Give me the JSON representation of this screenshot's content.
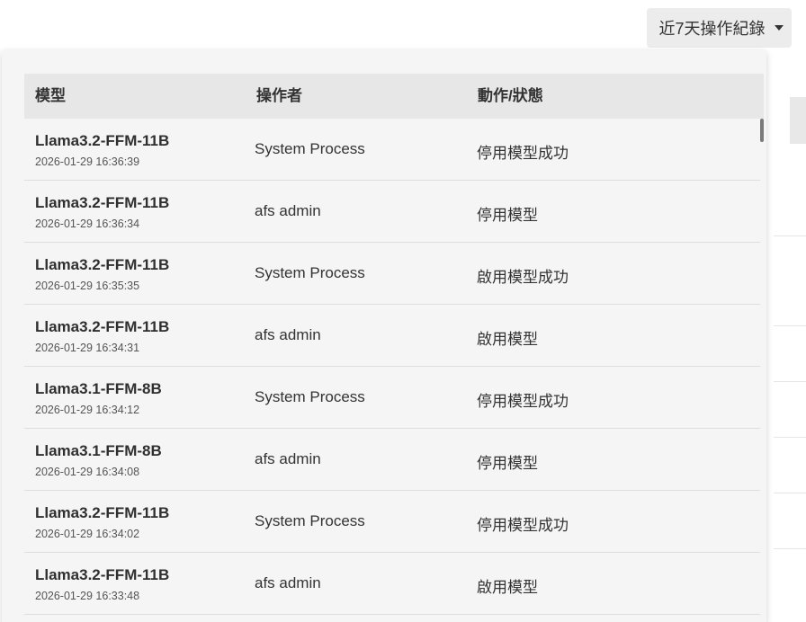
{
  "dropdown": {
    "label": "近7天操作紀錄",
    "icon": "caret-down-icon"
  },
  "table": {
    "headers": {
      "model": "模型",
      "operator": "操作者",
      "action": "動作/狀態"
    },
    "rows": [
      {
        "model": "Llama3.2-FFM-11B",
        "time": "2026-01-29 16:36:39",
        "operator": "System Process",
        "action": "停用模型成功"
      },
      {
        "model": "Llama3.2-FFM-11B",
        "time": "2026-01-29 16:36:34",
        "operator": "afs admin",
        "action": "停用模型"
      },
      {
        "model": "Llama3.2-FFM-11B",
        "time": "2026-01-29 16:35:35",
        "operator": "System Process",
        "action": "啟用模型成功"
      },
      {
        "model": "Llama3.2-FFM-11B",
        "time": "2026-01-29 16:34:31",
        "operator": "afs admin",
        "action": "啟用模型"
      },
      {
        "model": "Llama3.1-FFM-8B",
        "time": "2026-01-29 16:34:12",
        "operator": "System Process",
        "action": "停用模型成功"
      },
      {
        "model": "Llama3.1-FFM-8B",
        "time": "2026-01-29 16:34:08",
        "operator": "afs admin",
        "action": "停用模型"
      },
      {
        "model": "Llama3.2-FFM-11B",
        "time": "2026-01-29 16:34:02",
        "operator": "System Process",
        "action": "停用模型成功"
      },
      {
        "model": "Llama3.2-FFM-11B",
        "time": "2026-01-29 16:33:48",
        "operator": "afs admin",
        "action": "啟用模型"
      }
    ]
  }
}
